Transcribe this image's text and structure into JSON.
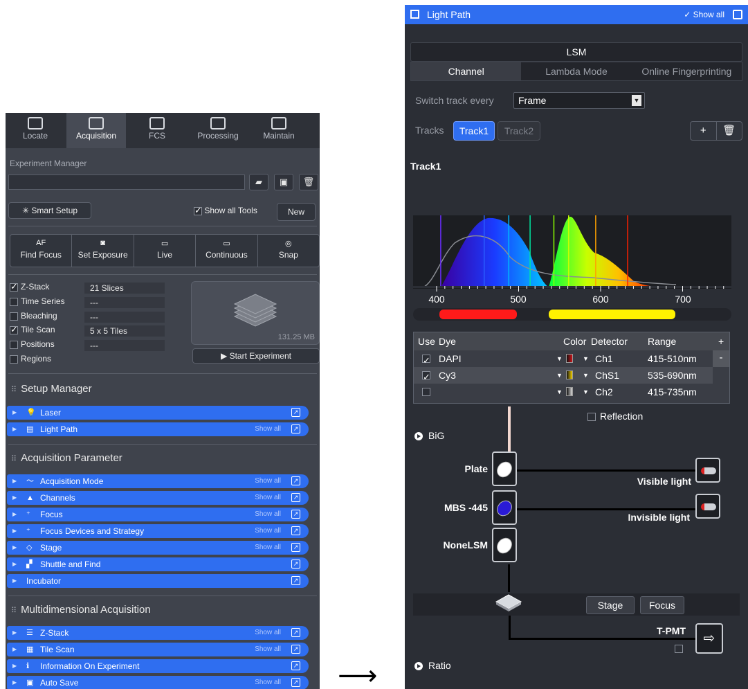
{
  "left_panel": {
    "tabs": [
      {
        "label": "Locate",
        "icon": "locate-icon",
        "active": false
      },
      {
        "label": "Acquisition",
        "icon": "acquisition-icon",
        "active": true
      },
      {
        "label": "FCS",
        "icon": "fcs-icon",
        "active": false
      },
      {
        "label": "Processing",
        "icon": "processing-icon",
        "active": false
      },
      {
        "label": "Maintain",
        "icon": "maintain-icon",
        "active": false
      }
    ],
    "experiment_manager": {
      "label": "Experiment Manager",
      "value": "",
      "smart_setup": "Smart Setup",
      "show_all_tools": "Show all Tools",
      "show_all_tools_checked": true,
      "new_button": "New"
    },
    "toolbar": [
      {
        "top": "AF",
        "label": "Find Focus"
      },
      {
        "top": "camera-icon",
        "label": "Set Exposure"
      },
      {
        "top": "live-icon",
        "label": "Live"
      },
      {
        "top": "continuous-icon",
        "label": "Continuous"
      },
      {
        "top": "snap-icon",
        "label": "Snap"
      }
    ],
    "experiment_options": [
      {
        "label": "Z-Stack",
        "checked": true,
        "value": "21 Slices"
      },
      {
        "label": "Time Series",
        "checked": false,
        "value": "---"
      },
      {
        "label": "Bleaching",
        "checked": false,
        "value": "---"
      },
      {
        "label": "Tile Scan",
        "checked": true,
        "value": "5 x 5 Tiles"
      },
      {
        "label": "Positions",
        "checked": false,
        "value": "---"
      },
      {
        "label": "Regions",
        "checked": false,
        "value": ""
      }
    ],
    "preview_size": "131.25 MB",
    "start_experiment": "Start Experiment",
    "groups": [
      {
        "title": "Setup Manager",
        "tools": [
          {
            "name": "Laser",
            "icon": "bulb-icon",
            "show_all": ""
          },
          {
            "name": "Light Path",
            "icon": "light-path-icon",
            "show_all": "Show all"
          }
        ]
      },
      {
        "title": "Acquisition Parameter",
        "tools": [
          {
            "name": "Acquisition Mode",
            "icon": "wave-icon",
            "show_all": "Show all"
          },
          {
            "name": "Channels",
            "icon": "triangle-icon",
            "show_all": "Show all"
          },
          {
            "name": "Focus",
            "icon": "focus-icon",
            "show_all": "Show all"
          },
          {
            "name": "Focus Devices and Strategy",
            "icon": "focus-icon",
            "show_all": "Show all"
          },
          {
            "name": "Stage",
            "icon": "stage-icon",
            "show_all": "Show all"
          },
          {
            "name": "Shuttle and Find",
            "icon": "shuttle-icon",
            "show_all": ""
          },
          {
            "name": "Incubator",
            "icon": "",
            "show_all": ""
          }
        ]
      },
      {
        "title": "Multidimensional Acquisition",
        "tools": [
          {
            "name": "Z-Stack",
            "icon": "zstack-icon",
            "show_all": "Show all"
          },
          {
            "name": "Tile Scan",
            "icon": "tiles-icon",
            "show_all": "Show all"
          },
          {
            "name": "Information On Experiment",
            "icon": "info-icon",
            "show_all": ""
          },
          {
            "name": "Auto Save",
            "icon": "save-icon",
            "show_all": "Show all"
          }
        ]
      }
    ]
  },
  "arrow": "⟶",
  "right_panel": {
    "header": {
      "title": "Light Path",
      "show_all": "✓ Show all"
    },
    "lsm_label": "LSM",
    "tabs": [
      {
        "label": "Channel",
        "active": true
      },
      {
        "label": "Lambda Mode",
        "active": false
      },
      {
        "label": "Online Fingerprinting",
        "active": false
      }
    ],
    "switch_track": {
      "label": "Switch track every",
      "value": "Frame"
    },
    "tracks": {
      "label": "Tracks",
      "items": [
        "Track1",
        "Track2"
      ],
      "active": "Track1"
    },
    "track_title": "Track1",
    "spectrum": {
      "ticks": [
        "400",
        "500",
        "600",
        "700"
      ],
      "lines_nm": [
        405,
        458,
        488,
        514,
        543,
        561,
        594,
        633
      ],
      "red_range": "415-510nm",
      "yellow_range": "535-690nm"
    },
    "dye_table": {
      "headers": [
        "Use",
        "Dye",
        "Color",
        "Detector",
        "Range"
      ],
      "rows": [
        {
          "use": true,
          "dye": "DAPI",
          "color": "#d0141a",
          "detector": "Ch1",
          "range": "415-510nm"
        },
        {
          "use": true,
          "dye": "Cy3",
          "color": "#f2d000",
          "detector": "ChS1",
          "range": "535-690nm"
        },
        {
          "use": false,
          "dye": "",
          "color": "#dcdcdc",
          "detector": "Ch2",
          "range": "415-735nm"
        }
      ],
      "add": "+",
      "remove": "-"
    },
    "reflection": "Reflection",
    "big": "BiG",
    "optics": [
      {
        "label": "Plate",
        "lens": "white"
      },
      {
        "label": "MBS -445",
        "lens": "blue"
      },
      {
        "label": "NoneLSM",
        "lens": "white"
      }
    ],
    "detectors": [
      {
        "label": "Visible light"
      },
      {
        "label": "Invisible light"
      }
    ],
    "stage_button": "Stage",
    "focus_button": "Focus",
    "tpmt": "T-PMT",
    "ratio": "Ratio"
  }
}
